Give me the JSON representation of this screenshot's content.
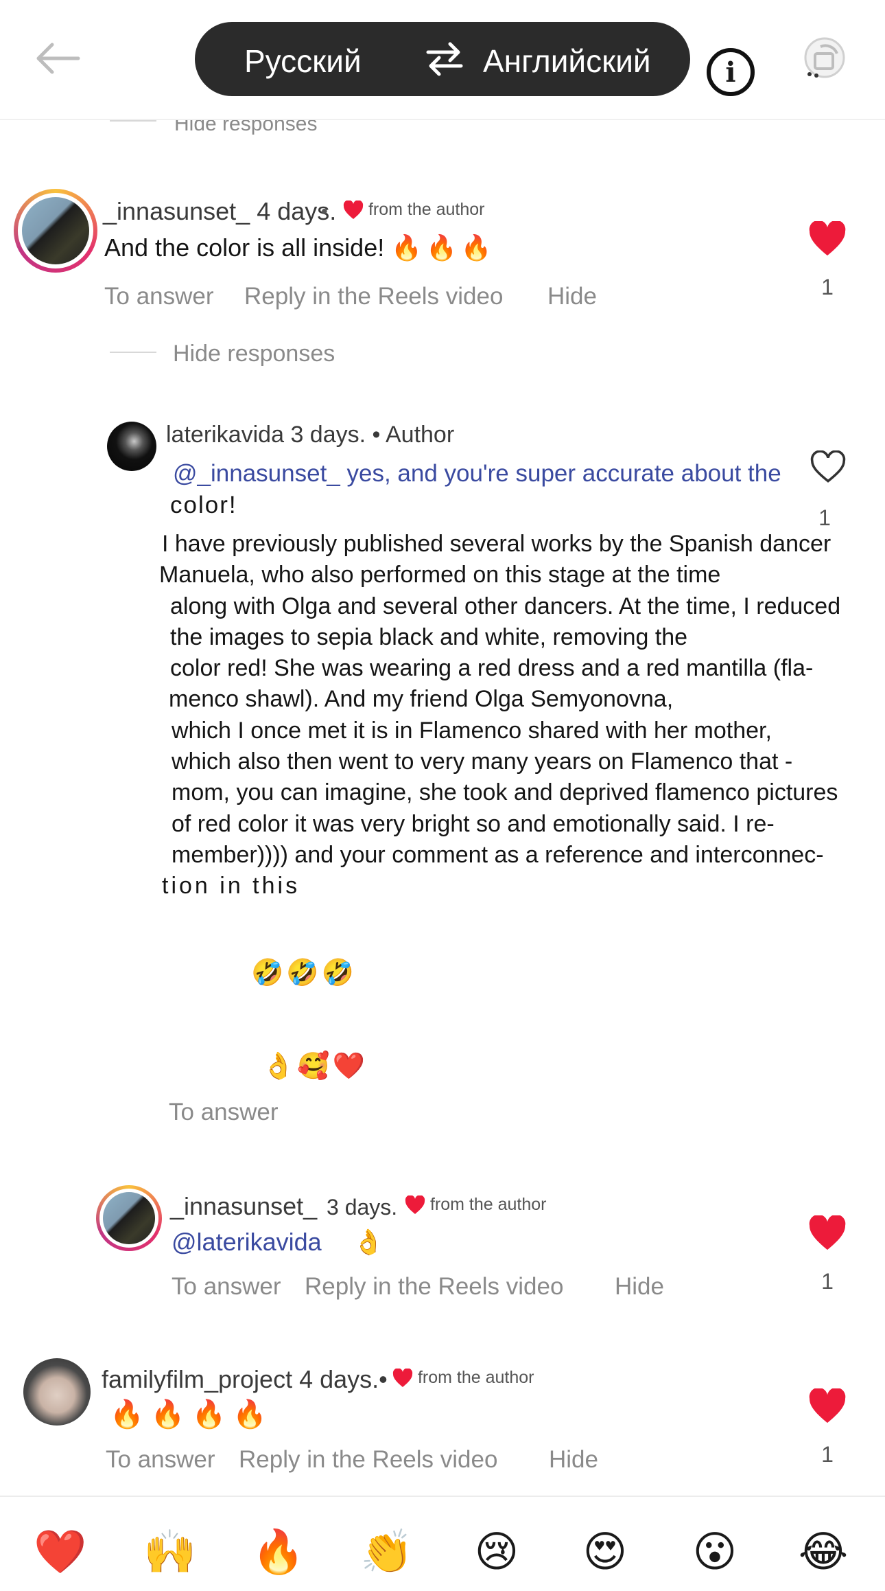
{
  "header": {
    "source_language": "Русский",
    "target_language": "Английский"
  },
  "thread": {
    "hide_responses_top": "Hide responses",
    "hide_responses": "Hide responses"
  },
  "comments": [
    {
      "username": "_innasunset_",
      "time": "4 days.",
      "separator": "•",
      "badge": "from the author",
      "text": "And the color is all inside!",
      "emojis": "🔥🔥🔥",
      "actions": [
        "To answer",
        "Reply in the Reels video",
        "Hide"
      ],
      "likes": "1",
      "liked": true
    },
    {
      "username": "laterikavida",
      "time": "3 days.",
      "role": "• Author",
      "mention": "@_innasunset_",
      "mention_text": "yes, and you're super accurate about the",
      "continuation": "color!",
      "body_lines": [
        "I have previously published several works by the Spanish dancer",
        "Manuela, who also performed on this stage at the time",
        "along with Olga and several other dancers. At the time, I reduced",
        "the images to sepia black and white, removing the",
        "color red! She was wearing a red dress and a red mantilla (fla-",
        "menco shawl). And my friend Olga Semyonovna,",
        "which I once met it is in Flamenco shared with her mother,",
        "which also then went to very many years on Flamenco that -",
        "mom, you can imagine, she took and deprived flamenco pictures",
        "of red color it was very bright so and emotionally said. I re-",
        "member)))) and your comment as a reference and interconnec-",
        "tion in this"
      ],
      "emojis_line1": "🤣🤣🤣",
      "emojis_line2": "👌🥰❤️",
      "actions": [
        "To answer"
      ],
      "likes": "1",
      "liked": false
    },
    {
      "username": "_innasunset_",
      "time": "3 days.",
      "badge": "from the author",
      "mention": "@laterikavida",
      "emojis": "👌",
      "actions": [
        "To answer",
        "Reply in the Reels video",
        "Hide"
      ],
      "likes": "1",
      "liked": true
    },
    {
      "username": "familyfilm_project",
      "time": "4 days.•",
      "badge": "from the author",
      "emojis": "🔥🔥🔥🔥",
      "actions": [
        "To answer",
        "Reply in the Reels video",
        "Hide"
      ],
      "likes": "1",
      "liked": true
    }
  ],
  "reaction_bar": [
    "❤️",
    "🙌",
    "🔥",
    "👏",
    "😢",
    "😍",
    "😮",
    "😂"
  ],
  "colors": {
    "like_red": "#ed1b3a",
    "pill_bg": "#2b2b2b",
    "mention_blue": "#3a4aa0"
  }
}
